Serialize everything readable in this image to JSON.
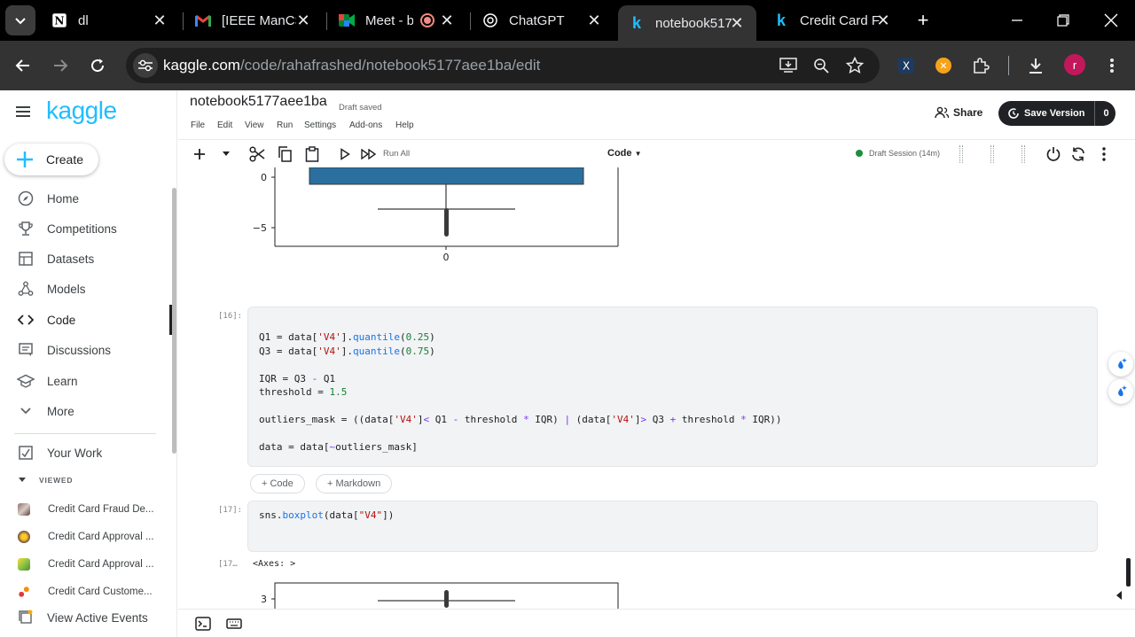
{
  "browser": {
    "tabs": [
      {
        "title": "dl",
        "icon": "notion-icon"
      },
      {
        "title": "[IEEE ManCSC",
        "icon": "gmail-icon"
      },
      {
        "title": "Meet - b",
        "icon": "meet-icon"
      },
      {
        "title": "ChatGPT",
        "icon": "chatgpt-icon"
      },
      {
        "title": "notebook517",
        "icon": "kaggle-icon"
      },
      {
        "title": "Credit Card F",
        "icon": "kaggle-icon"
      }
    ],
    "url_host": "kaggle.com",
    "url_path": "/code/rahafrashed/notebook5177aee1ba/edit",
    "profile_initial": "r",
    "colors": {
      "chrome_bg": "#000000",
      "toolbar_bg": "#333333",
      "profile": "#c2185b"
    }
  },
  "kaggle": {
    "logo": "kaggle",
    "create_label": "Create",
    "nav": [
      {
        "label": "Home",
        "icon": "compass-icon"
      },
      {
        "label": "Competitions",
        "icon": "trophy-icon"
      },
      {
        "label": "Datasets",
        "icon": "table-icon"
      },
      {
        "label": "Models",
        "icon": "models-icon"
      },
      {
        "label": "Code",
        "icon": "code-icon"
      },
      {
        "label": "Discussions",
        "icon": "comments-icon"
      },
      {
        "label": "Learn",
        "icon": "school-icon"
      },
      {
        "label": "More",
        "icon": "chevron-down-icon"
      }
    ],
    "your_work": "Your Work",
    "viewed_label": "VIEWED",
    "recent": [
      "Credit Card Fraud De...",
      "Credit Card Approval ...",
      "Credit Card Approval ...",
      "Credit Card Custome..."
    ],
    "active_events": "View Active Events",
    "accent": "#20beff"
  },
  "notebook": {
    "title": "notebook5177aee1ba",
    "draft_status": "Draft saved",
    "menu": [
      "File",
      "Edit",
      "View",
      "Run",
      "Settings",
      "Add-ons",
      "Help"
    ],
    "share_label": "Share",
    "save_version_label": "Save Version",
    "save_version_count": "0",
    "run_all_label": "Run All",
    "cell_type": "Code",
    "session": "Draft Session (14m)",
    "add_code": "+ Code",
    "add_markdown": "+ Markdown",
    "cells": [
      {
        "exec": "[16]:"
      },
      {
        "exec": "[17]:"
      }
    ],
    "output_exec": "[17…",
    "output_text": "<Axes: >",
    "plot_top": {
      "ytick_0": "0",
      "ytick_neg5": "−5",
      "xtick": "0"
    },
    "plot_bottom": {
      "ytick_3": "3"
    }
  }
}
